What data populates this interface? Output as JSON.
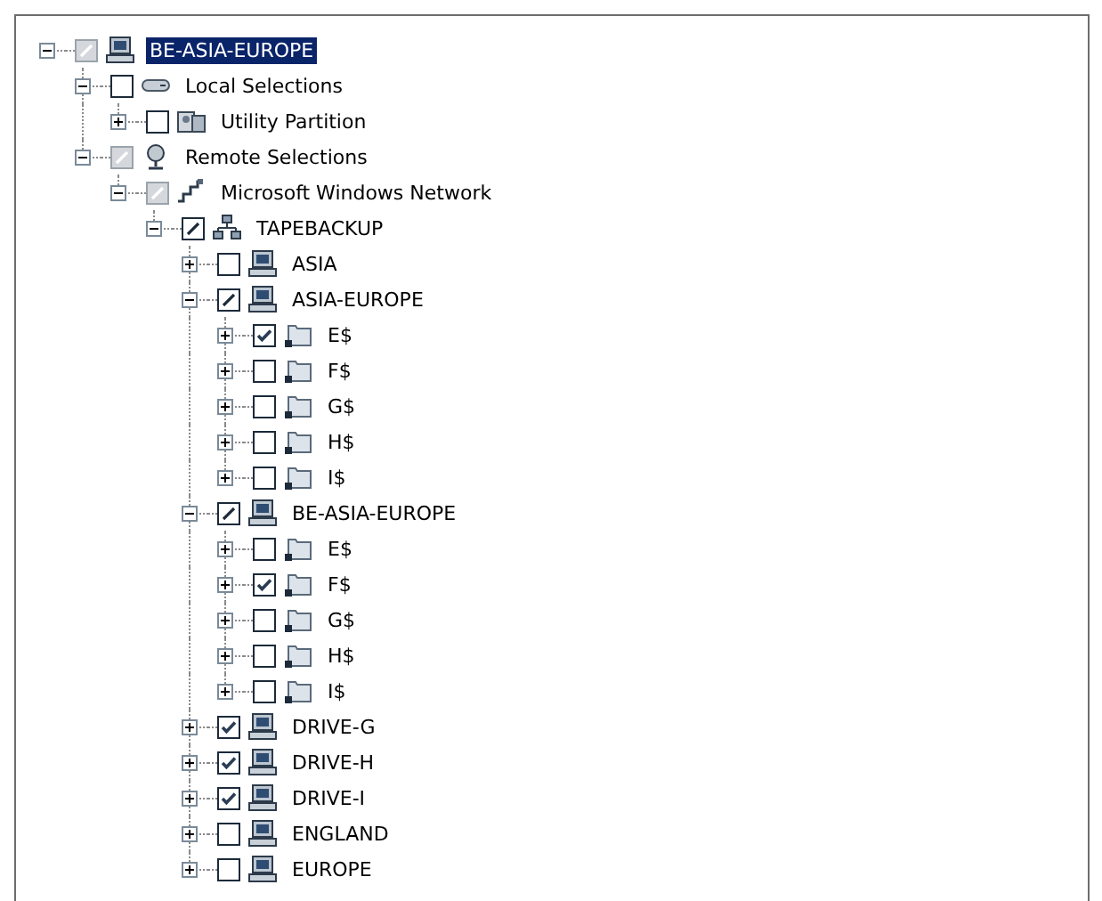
{
  "tree": [
    {
      "label": "BE-ASIA-EUROPE",
      "kind": "server",
      "checked": false,
      "partial": true,
      "dimmed": true,
      "expanded": true,
      "selected": true,
      "children": [
        {
          "label": "Local Selections",
          "kind": "drive",
          "checked": false,
          "partial": false,
          "dimmed": false,
          "expanded": true,
          "selected": false,
          "children": [
            {
              "label": "Utility Partition",
              "kind": "utility",
              "checked": false,
              "partial": false,
              "dimmed": false,
              "expanded": false,
              "selected": false
            }
          ]
        },
        {
          "label": "Remote Selections",
          "kind": "globe",
          "checked": false,
          "partial": true,
          "dimmed": true,
          "expanded": true,
          "selected": false,
          "children": [
            {
              "label": "Microsoft Windows Network",
              "kind": "network",
              "checked": false,
              "partial": true,
              "dimmed": true,
              "expanded": true,
              "selected": false,
              "children": [
                {
                  "label": "TAPEBACKUP",
                  "kind": "workgroup",
                  "checked": false,
                  "partial": true,
                  "dimmed": false,
                  "expanded": true,
                  "selected": false,
                  "children": [
                    {
                      "label": "ASIA",
                      "kind": "computer",
                      "checked": false,
                      "partial": false,
                      "dimmed": false,
                      "expanded": false,
                      "selected": false
                    },
                    {
                      "label": "ASIA-EUROPE",
                      "kind": "computer",
                      "checked": false,
                      "partial": true,
                      "dimmed": false,
                      "expanded": true,
                      "selected": false,
                      "children": [
                        {
                          "label": "E$",
                          "kind": "share",
                          "checked": true,
                          "partial": false,
                          "dimmed": false,
                          "expanded": false,
                          "selected": false
                        },
                        {
                          "label": "F$",
                          "kind": "share",
                          "checked": false,
                          "partial": false,
                          "dimmed": false,
                          "expanded": false,
                          "selected": false
                        },
                        {
                          "label": "G$",
                          "kind": "share",
                          "checked": false,
                          "partial": false,
                          "dimmed": false,
                          "expanded": false,
                          "selected": false
                        },
                        {
                          "label": "H$",
                          "kind": "share",
                          "checked": false,
                          "partial": false,
                          "dimmed": false,
                          "expanded": false,
                          "selected": false
                        },
                        {
                          "label": "I$",
                          "kind": "share",
                          "checked": false,
                          "partial": false,
                          "dimmed": false,
                          "expanded": false,
                          "selected": false
                        }
                      ]
                    },
                    {
                      "label": "BE-ASIA-EUROPE",
                      "kind": "computer",
                      "checked": false,
                      "partial": true,
                      "dimmed": false,
                      "expanded": true,
                      "selected": false,
                      "children": [
                        {
                          "label": "E$",
                          "kind": "share",
                          "checked": false,
                          "partial": false,
                          "dimmed": false,
                          "expanded": false,
                          "selected": false
                        },
                        {
                          "label": "F$",
                          "kind": "share",
                          "checked": true,
                          "partial": false,
                          "dimmed": false,
                          "expanded": false,
                          "selected": false
                        },
                        {
                          "label": "G$",
                          "kind": "share",
                          "checked": false,
                          "partial": false,
                          "dimmed": false,
                          "expanded": false,
                          "selected": false
                        },
                        {
                          "label": "H$",
                          "kind": "share",
                          "checked": false,
                          "partial": false,
                          "dimmed": false,
                          "expanded": false,
                          "selected": false
                        },
                        {
                          "label": "I$",
                          "kind": "share",
                          "checked": false,
                          "partial": false,
                          "dimmed": false,
                          "expanded": false,
                          "selected": false
                        }
                      ]
                    },
                    {
                      "label": "DRIVE-G",
                      "kind": "computer",
                      "checked": true,
                      "partial": false,
                      "dimmed": false,
                      "expanded": false,
                      "selected": false
                    },
                    {
                      "label": "DRIVE-H",
                      "kind": "computer",
                      "checked": true,
                      "partial": false,
                      "dimmed": false,
                      "expanded": false,
                      "selected": false
                    },
                    {
                      "label": "DRIVE-I",
                      "kind": "computer",
                      "checked": true,
                      "partial": false,
                      "dimmed": false,
                      "expanded": false,
                      "selected": false
                    },
                    {
                      "label": "ENGLAND",
                      "kind": "computer",
                      "checked": false,
                      "partial": false,
                      "dimmed": false,
                      "expanded": false,
                      "selected": false
                    },
                    {
                      "label": "EUROPE",
                      "kind": "computer",
                      "checked": false,
                      "partial": false,
                      "dimmed": false,
                      "expanded": false,
                      "selected": false
                    }
                  ]
                }
              ]
            }
          ]
        }
      ]
    }
  ]
}
